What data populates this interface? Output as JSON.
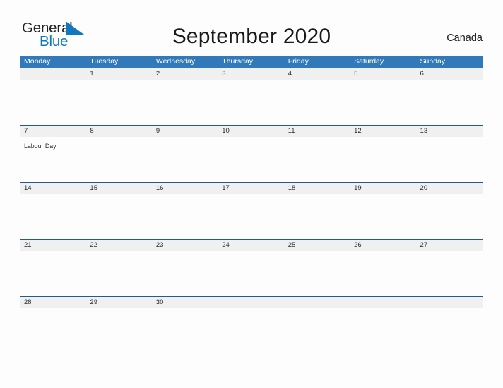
{
  "brand": {
    "name_part1": "General",
    "name_part2": "Blue",
    "flag_color": "#1278be",
    "text_color": "#231f20"
  },
  "header": {
    "title": "September 2020",
    "country": "Canada"
  },
  "theme": {
    "header_blue": "#3179b9",
    "row_rule_blue": "#1f5c94",
    "band_gray": "#f0f0f0",
    "page_background": "#fdfdfd"
  },
  "calendar": {
    "weekdays": [
      "Monday",
      "Tuesday",
      "Wednesday",
      "Thursday",
      "Friday",
      "Saturday",
      "Sunday"
    ],
    "weeks": [
      {
        "days": [
          {
            "num": "",
            "event": ""
          },
          {
            "num": "1",
            "event": ""
          },
          {
            "num": "2",
            "event": ""
          },
          {
            "num": "3",
            "event": ""
          },
          {
            "num": "4",
            "event": ""
          },
          {
            "num": "5",
            "event": ""
          },
          {
            "num": "6",
            "event": ""
          }
        ]
      },
      {
        "days": [
          {
            "num": "7",
            "event": "Labour Day"
          },
          {
            "num": "8",
            "event": ""
          },
          {
            "num": "9",
            "event": ""
          },
          {
            "num": "10",
            "event": ""
          },
          {
            "num": "11",
            "event": ""
          },
          {
            "num": "12",
            "event": ""
          },
          {
            "num": "13",
            "event": ""
          }
        ]
      },
      {
        "days": [
          {
            "num": "14",
            "event": ""
          },
          {
            "num": "15",
            "event": ""
          },
          {
            "num": "16",
            "event": ""
          },
          {
            "num": "17",
            "event": ""
          },
          {
            "num": "18",
            "event": ""
          },
          {
            "num": "19",
            "event": ""
          },
          {
            "num": "20",
            "event": ""
          }
        ]
      },
      {
        "days": [
          {
            "num": "21",
            "event": ""
          },
          {
            "num": "22",
            "event": ""
          },
          {
            "num": "23",
            "event": ""
          },
          {
            "num": "24",
            "event": ""
          },
          {
            "num": "25",
            "event": ""
          },
          {
            "num": "26",
            "event": ""
          },
          {
            "num": "27",
            "event": ""
          }
        ]
      },
      {
        "days": [
          {
            "num": "28",
            "event": ""
          },
          {
            "num": "29",
            "event": ""
          },
          {
            "num": "30",
            "event": ""
          },
          {
            "num": "",
            "event": ""
          },
          {
            "num": "",
            "event": ""
          },
          {
            "num": "",
            "event": ""
          },
          {
            "num": "",
            "event": ""
          }
        ]
      }
    ]
  }
}
